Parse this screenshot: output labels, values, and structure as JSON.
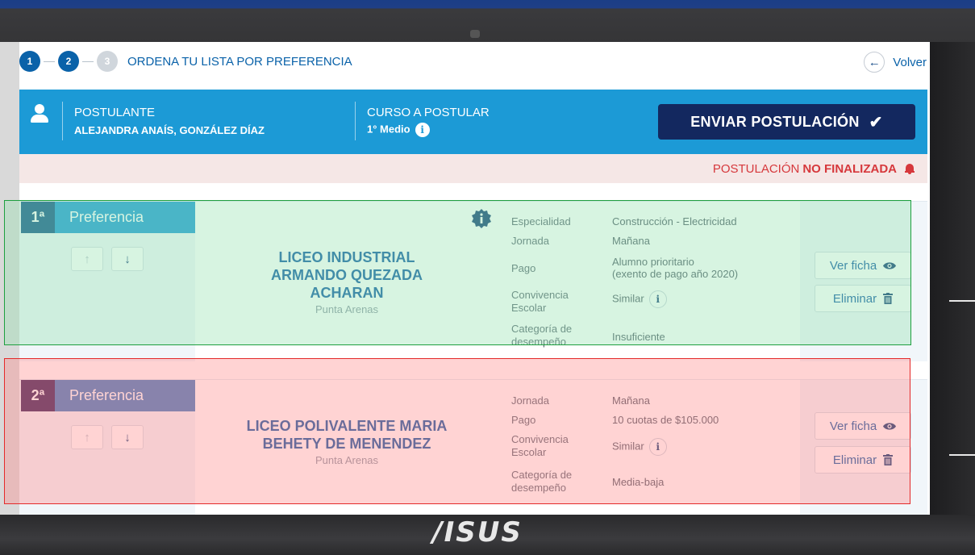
{
  "stepper": {
    "steps": [
      "1",
      "2",
      "3"
    ],
    "title": "ORDENA TU LISTA POR PREFERENCIA"
  },
  "back_label": "Volver",
  "applicant": {
    "label": "POSTULANTE",
    "name": "ALEJANDRA ANAÍS, GONZÁLEZ DÍAZ"
  },
  "course": {
    "label": "CURSO A POSTULAR",
    "value": "1° Medio"
  },
  "send_button": "ENVIAR POSTULACIÓN",
  "status": {
    "prefix": "POSTULACIÓN",
    "emphasis": "NO FINALIZADA"
  },
  "preferences": [
    {
      "rank": "1ª",
      "label": "Preferencia",
      "school": [
        "LICEO INDUSTRIAL",
        "ARMANDO QUEZADA",
        "ACHARAN"
      ],
      "city": "Punta Arenas",
      "details": {
        "especialidad_key": "Especialidad",
        "especialidad_val": "Construcción - Electricidad",
        "jornada_key": "Jornada",
        "jornada_val": "Mañana",
        "pago_key": "Pago",
        "pago_val_1": "Alumno prioritario",
        "pago_val_2": "(exento de pago año 2020)",
        "convivencia_key_1": "Convivencia",
        "convivencia_key_2": "Escolar",
        "convivencia_val": "Similar",
        "categoria_key_1": "Categoría de",
        "categoria_key_2": "desempeño",
        "categoria_val": "Insuficiente"
      },
      "ver_ficha": "Ver ficha",
      "eliminar": "Eliminar",
      "tab_color": "#1c9ad6",
      "num_color": "#0f5488"
    },
    {
      "rank": "2ª",
      "label": "Preferencia",
      "school": [
        "LICEO POLIVALENTE MARIA",
        "BEHETY DE MENENDEZ"
      ],
      "city": "Punta Arenas",
      "details": {
        "jornada_key": "Jornada",
        "jornada_val": "Mañana",
        "pago_key": "Pago",
        "pago_val_1": "10 cuotas de $105.000",
        "convivencia_key_1": "Convivencia",
        "convivencia_key_2": "Escolar",
        "convivencia_val": "Similar",
        "categoria_key_1": "Categoría de",
        "categoria_key_2": "desempeño",
        "categoria_val": "Media-baja"
      },
      "ver_ficha": "Ver ficha",
      "eliminar": "Eliminar",
      "tab_color": "#3f7fc1",
      "num_color": "#3b2358"
    }
  ],
  "laptop_brand": "/ISUS",
  "colors": {
    "primary": "#1c9ad6",
    "dark_navy": "#13285f",
    "alert": "#d6383c",
    "highlight_green": "#1e9f3f",
    "highlight_red": "#e42a2a"
  }
}
